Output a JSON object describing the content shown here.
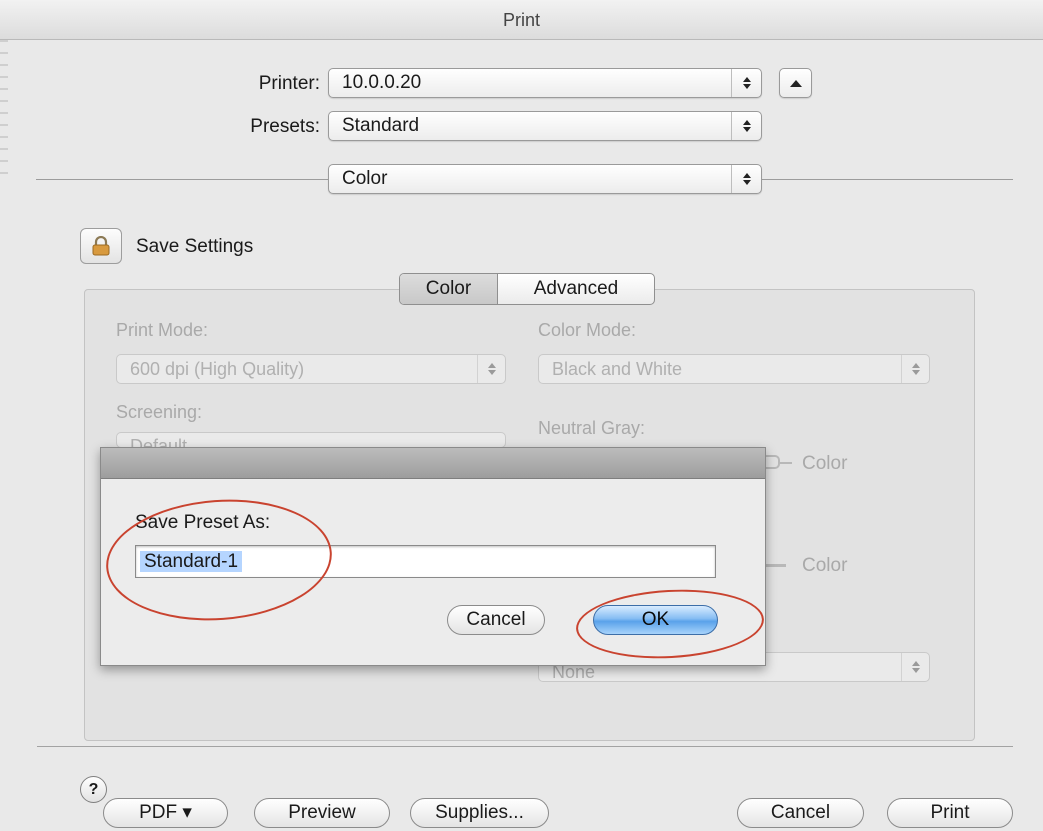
{
  "window": {
    "title": "Print"
  },
  "printer": {
    "label": "Printer:",
    "value": "10.0.0.20"
  },
  "presets": {
    "label": "Presets:",
    "value": "Standard"
  },
  "pane_selector": {
    "value": "Color"
  },
  "save_settings": {
    "label": "Save Settings"
  },
  "tabs": [
    {
      "label": "Color",
      "selected": true
    },
    {
      "label": "Advanced",
      "selected": false
    }
  ],
  "panel": {
    "print_mode": {
      "label": "Print Mode:",
      "value": "600 dpi (High Quality)"
    },
    "screening": {
      "label": "Screening:",
      "value": "Default"
    },
    "color_mode": {
      "label": "Color Mode:",
      "value": "Black and White"
    },
    "neutral_gray": {
      "label": "Neutral Gray:",
      "option_1": "Color",
      "option_2": "Color"
    },
    "bottom_select": {
      "value": "None"
    }
  },
  "sheet": {
    "prompt": "Save Preset As:",
    "field_value": "Standard-1",
    "cancel_label": "Cancel",
    "ok_label": "OK"
  },
  "footer": {
    "help_label": "?",
    "pdf_label": "PDF ▾",
    "preview_label": "Preview",
    "supplies_label": "Supplies...",
    "cancel_label": "Cancel",
    "print_label": "Print"
  },
  "colors": {
    "annotation_ring": "#c9432f",
    "default_button": "#5aa2ea",
    "selection": "#b5d5ff"
  }
}
